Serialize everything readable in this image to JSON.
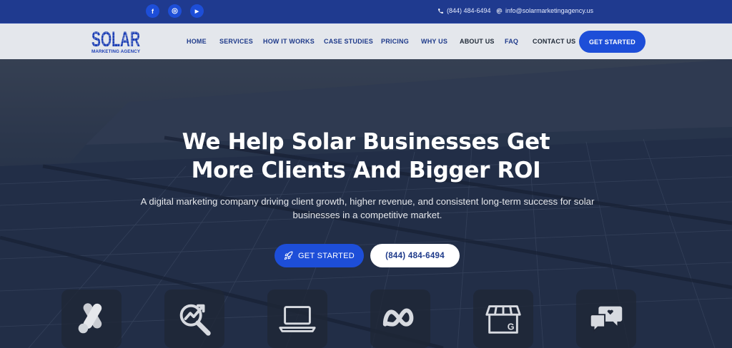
{
  "topbar": {
    "social": [
      {
        "name": "facebook-icon",
        "glyph": "f"
      },
      {
        "name": "instagram-icon",
        "glyph": "◎"
      },
      {
        "name": "youtube-icon",
        "glyph": "▶"
      }
    ],
    "phone": "(844) 484-6494",
    "email": "info@solarmarketingagency.us"
  },
  "logo": {
    "word": "SOLAR",
    "subtitle": "MARKETING AGENCY"
  },
  "nav": {
    "items": [
      "HOME",
      "SERVICES",
      "HOW IT WORKS",
      "CASE STUDIES",
      "PRICING",
      "WHY US",
      "ABOUT US",
      "FAQ",
      "CONTACT US"
    ],
    "cta": "GET STARTED"
  },
  "hero": {
    "title_line1": "We Help Solar Businesses Get",
    "title_line2": "More Clients And Bigger ROI",
    "subtitle_line1": "A digital marketing company driving client growth, higher revenue, and consistent long-term success for solar",
    "subtitle_line2": "businesses in a competitive market.",
    "primary_button": "GET STARTED",
    "secondary_button": "(844) 484-6494"
  },
  "services": {
    "icons": [
      "google-ads-icon",
      "seo-analytics-icon",
      "web-design-laptop-icon",
      "meta-ads-icon",
      "google-business-profile-icon",
      "social-engagement-icon"
    ]
  },
  "colors": {
    "brand_blue": "#1d4ed8",
    "topbar": "#1f3a8f",
    "nav_text": "#1e3a8a",
    "navbar_bg": "#e4e7ec"
  }
}
